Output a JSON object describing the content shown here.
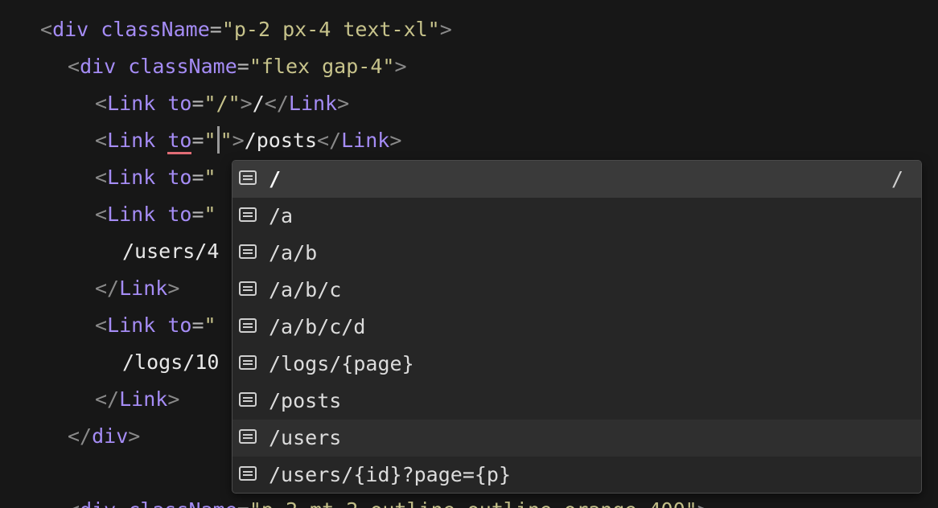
{
  "code": {
    "line0": {
      "attr": "className",
      "value": "\"p-2 px-4 text-xl\""
    },
    "line1": {
      "attr": "className",
      "value": "\"flex gap-4\""
    },
    "line2": {
      "attr": "to",
      "value": "\"/\"",
      "text": "/"
    },
    "line3": {
      "attr": "to",
      "value_open": "\"",
      "value_close": "\"",
      "text": "/posts"
    },
    "line4": {
      "attr": "to",
      "value": "\""
    },
    "line5": {
      "attr": "to",
      "value": "\""
    },
    "line6": {
      "text": "/users/4"
    },
    "line8": {
      "attr": "to",
      "value": "\""
    },
    "line9": {
      "text": "/logs/10"
    },
    "line_bottom": {
      "attr": "className",
      "value": "\"p-2 mt-2 outline outline-orange-400\""
    },
    "tag_div": "div",
    "tag_link": "Link"
  },
  "suggestions": {
    "items": [
      {
        "label": "/",
        "detail": "/",
        "icon": "text-icon",
        "state": "selected"
      },
      {
        "label": "/a",
        "icon": "text-icon"
      },
      {
        "label": "/a/b",
        "icon": "text-icon"
      },
      {
        "label": "/a/b/c",
        "icon": "text-icon"
      },
      {
        "label": "/a/b/c/d",
        "icon": "text-icon"
      },
      {
        "label": "/logs/{page}",
        "icon": "text-icon"
      },
      {
        "label": "/posts",
        "icon": "text-icon"
      },
      {
        "label": "/users",
        "icon": "text-icon",
        "state": "hover"
      },
      {
        "label": "/users/{id}?page={p}",
        "icon": "text-icon"
      }
    ]
  },
  "colors": {
    "background": "#171717",
    "tag": "#a58cf5",
    "string": "#c7c38b",
    "error_underline": "#e06c75",
    "popup_bg": "#262626",
    "popup_selected": "#3a3a3a"
  }
}
